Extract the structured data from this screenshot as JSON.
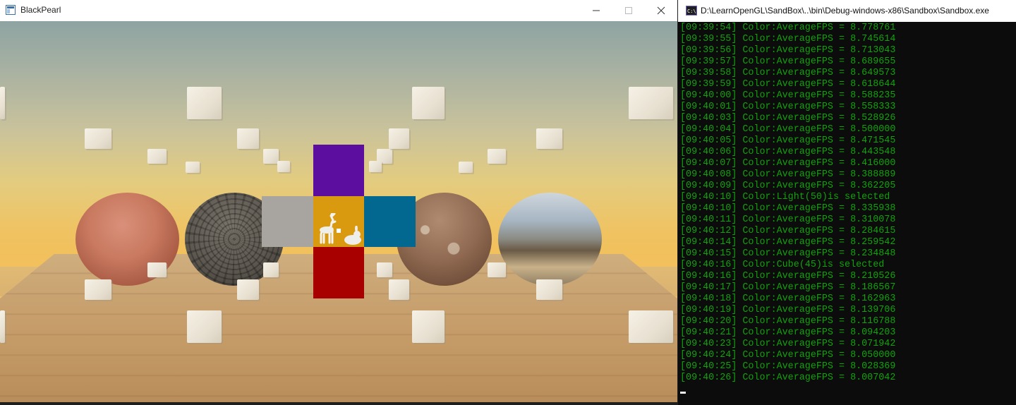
{
  "bp_window": {
    "title": "BlackPearl",
    "icon": "app-icon",
    "controls": [
      "minimize-icon",
      "maximize-icon",
      "close-icon"
    ]
  },
  "console_window": {
    "title": "D:\\LearnOpenGL\\SandBox\\..\\bin\\Debug-windows-x86\\Sandbox\\Sandbox.exe",
    "icon": "console-icon",
    "text_color": "#13a10e",
    "background_color": "#0c0c0c",
    "log": [
      "[09:39:54] Color:AverageFPS = 8.778761",
      "[09:39:55] Color:AverageFPS = 8.745614",
      "[09:39:56] Color:AverageFPS = 8.713043",
      "[09:39:57] Color:AverageFPS = 8.689655",
      "[09:39:58] Color:AverageFPS = 8.649573",
      "[09:39:59] Color:AverageFPS = 8.618644",
      "[09:40:00] Color:AverageFPS = 8.588235",
      "[09:40:01] Color:AverageFPS = 8.558333",
      "[09:40:03] Color:AverageFPS = 8.528926",
      "[09:40:04] Color:AverageFPS = 8.500000",
      "[09:40:05] Color:AverageFPS = 8.471545",
      "[09:40:06] Color:AverageFPS = 8.443548",
      "[09:40:07] Color:AverageFPS = 8.416000",
      "[09:40:08] Color:AverageFPS = 8.388889",
      "[09:40:09] Color:AverageFPS = 8.362205",
      "[09:40:10] Color:Light(50)is selected",
      "[09:40:10] Color:AverageFPS = 8.335938",
      "[09:40:11] Color:AverageFPS = 8.310078",
      "[09:40:12] Color:AverageFPS = 8.284615",
      "[09:40:14] Color:AverageFPS = 8.259542",
      "[09:40:15] Color:AverageFPS = 8.234848",
      "[09:40:16] Color:Cube(45)is selected",
      "[09:40:16] Color:AverageFPS = 8.210526",
      "[09:40:17] Color:AverageFPS = 8.186567",
      "[09:40:18] Color:AverageFPS = 8.162963",
      "[09:40:19] Color:AverageFPS = 8.139706",
      "[09:40:20] Color:AverageFPS = 8.116788",
      "[09:40:21] Color:AverageFPS = 8.094203",
      "[09:40:23] Color:AverageFPS = 8.071942",
      "[09:40:24] Color:AverageFPS = 8.050000",
      "[09:40:25] Color:AverageFPS = 8.028369",
      "[09:40:26] Color:AverageFPS = 8.007042"
    ]
  },
  "scene": {
    "cornell_box_colors": {
      "top": "#5c0f9e",
      "left": "#a8a49f",
      "center": "#d99a10",
      "right": "#02688f",
      "bottom": "#a80000"
    },
    "spheres": [
      "copper",
      "stone",
      "rust",
      "chrome"
    ]
  }
}
